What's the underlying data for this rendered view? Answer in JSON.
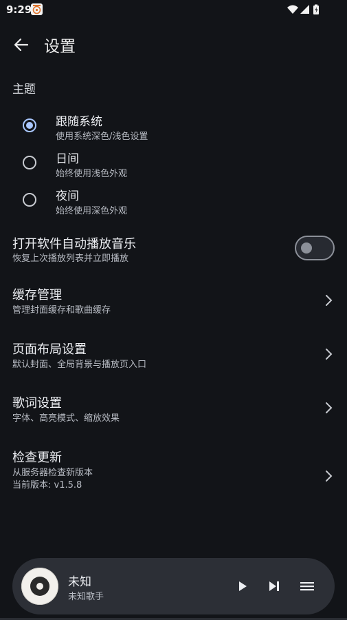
{
  "status_bar": {
    "time": "9:29",
    "icons": [
      "app-notification-icon",
      "wifi-icon",
      "signal-icon",
      "battery-icon"
    ]
  },
  "header": {
    "title": "设置",
    "back_icon": "arrow-left-icon"
  },
  "theme": {
    "section_label": "主题",
    "accent_color": "#a9c7ff",
    "options": [
      {
        "title": "跟随系统",
        "subtitle": "使用系统深色/浅色设置",
        "selected": true
      },
      {
        "title": "日间",
        "subtitle": "始终使用浅色外观",
        "selected": false
      },
      {
        "title": "夜间",
        "subtitle": "始终使用深色外观",
        "selected": false
      }
    ]
  },
  "autoplay": {
    "title": "打开软件自动播放音乐",
    "subtitle": "恢复上次播放列表并立即播放",
    "enabled": false
  },
  "items": [
    {
      "title": "缓存管理",
      "subtitle": "管理封面缓存和歌曲缓存"
    },
    {
      "title": "页面布局设置",
      "subtitle": "默认封面、全局背景与播放页入口"
    },
    {
      "title": "歌词设置",
      "subtitle": "字体、高亮模式、缩放效果"
    },
    {
      "title": "检查更新",
      "subtitle": "从服务器检查新版本",
      "subtitle2": "当前版本: v1.5.8"
    }
  ],
  "player": {
    "title": "未知",
    "artist": "未知歌手",
    "icons": [
      "play-icon",
      "skip-next-icon",
      "queue-menu-icon"
    ]
  },
  "colors": {
    "background": "#121418",
    "player_bar": "#2c2f36",
    "text_primary": "#eceef2",
    "text_secondary": "#b8bcc4"
  }
}
